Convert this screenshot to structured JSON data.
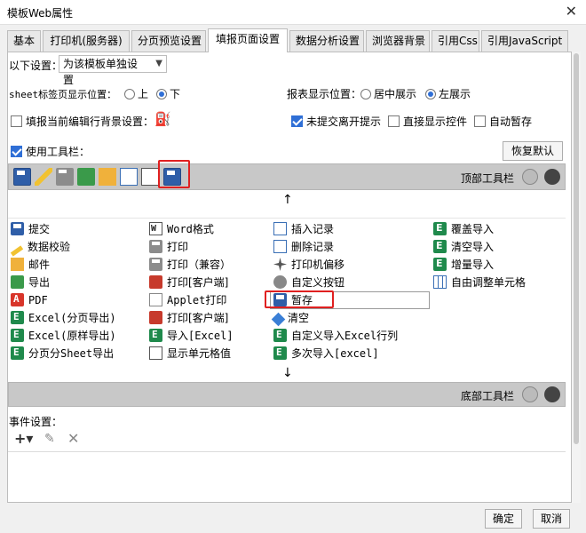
{
  "window": {
    "title": "模板Web属性",
    "close": "✕"
  },
  "tabs": [
    {
      "label": "基本"
    },
    {
      "label": "打印机(服务器)"
    },
    {
      "label": "分页预览设置"
    },
    {
      "label": "填报页面设置"
    },
    {
      "label": "数据分析设置"
    },
    {
      "label": "浏览器背景"
    },
    {
      "label": "引用Css"
    },
    {
      "label": "引用JavaScript"
    }
  ],
  "settings": {
    "scope_label": "以下设置：",
    "scope_value": "为该模板单独设置",
    "sheet_tab_label": "sheet标签页显示位置：",
    "sheet_tab_up": "上",
    "sheet_tab_down": "下",
    "report_pos_label": "报表显示位置：",
    "report_center": "居中展示",
    "report_left": "左展示",
    "fill_bg_label": "填报当前编辑行背景设置：",
    "unsubmitted_tip": "未提交离开提示",
    "show_controls": "直接显示控件",
    "auto_save": "自动暂存",
    "use_toolbar": "使用工具栏：",
    "restore_default": "恢复默认"
  },
  "top_toolbar": {
    "label": "顶部工具栏",
    "arrow": "↑"
  },
  "bottom_toolbar": {
    "label": "底部工具栏",
    "arrow": "↓"
  },
  "items": {
    "col1": [
      "提交",
      "数据校验",
      "邮件",
      "导出",
      "PDF",
      "Excel(分页导出)",
      "Excel(原样导出)",
      "分页分Sheet导出"
    ],
    "col2": [
      "Word格式",
      "打印",
      "打印（兼容）",
      "打印[客户端]",
      "Applet打印",
      "打印[客户端]",
      "导入[Excel]",
      "显示单元格值"
    ],
    "col3": [
      "插入记录",
      "删除记录",
      "打印机偏移",
      "自定义按钮",
      "暂存",
      "清空",
      "自定义导入Excel行列",
      "多次导入[excel]"
    ],
    "col4": [
      "覆盖导入",
      "清空导入",
      "增量导入",
      "自由调整单元格"
    ]
  },
  "event": {
    "label": "事件设置："
  },
  "footer": {
    "ok": "确定",
    "cancel": "取消"
  }
}
